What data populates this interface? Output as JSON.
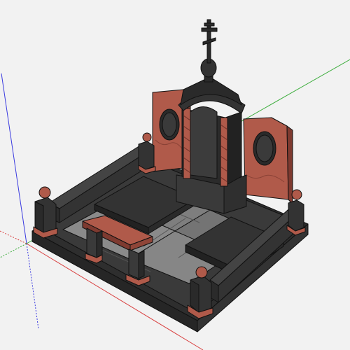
{
  "viewport": {
    "background": "#f2f2f2",
    "axes": {
      "x_color": "#d94040",
      "y_color": "#3fae3f",
      "z_color": "#3a3ae0"
    }
  },
  "model": {
    "black_granite": "#3a3a3a",
    "black_granite_dark": "#252525",
    "black_granite_light": "#4c4c4c",
    "red_granite": "#b05a4a",
    "red_granite_dark": "#7e3a30",
    "tile_light": "#8a8a8a",
    "tile_mid": "#747474",
    "edge": "#111111"
  }
}
